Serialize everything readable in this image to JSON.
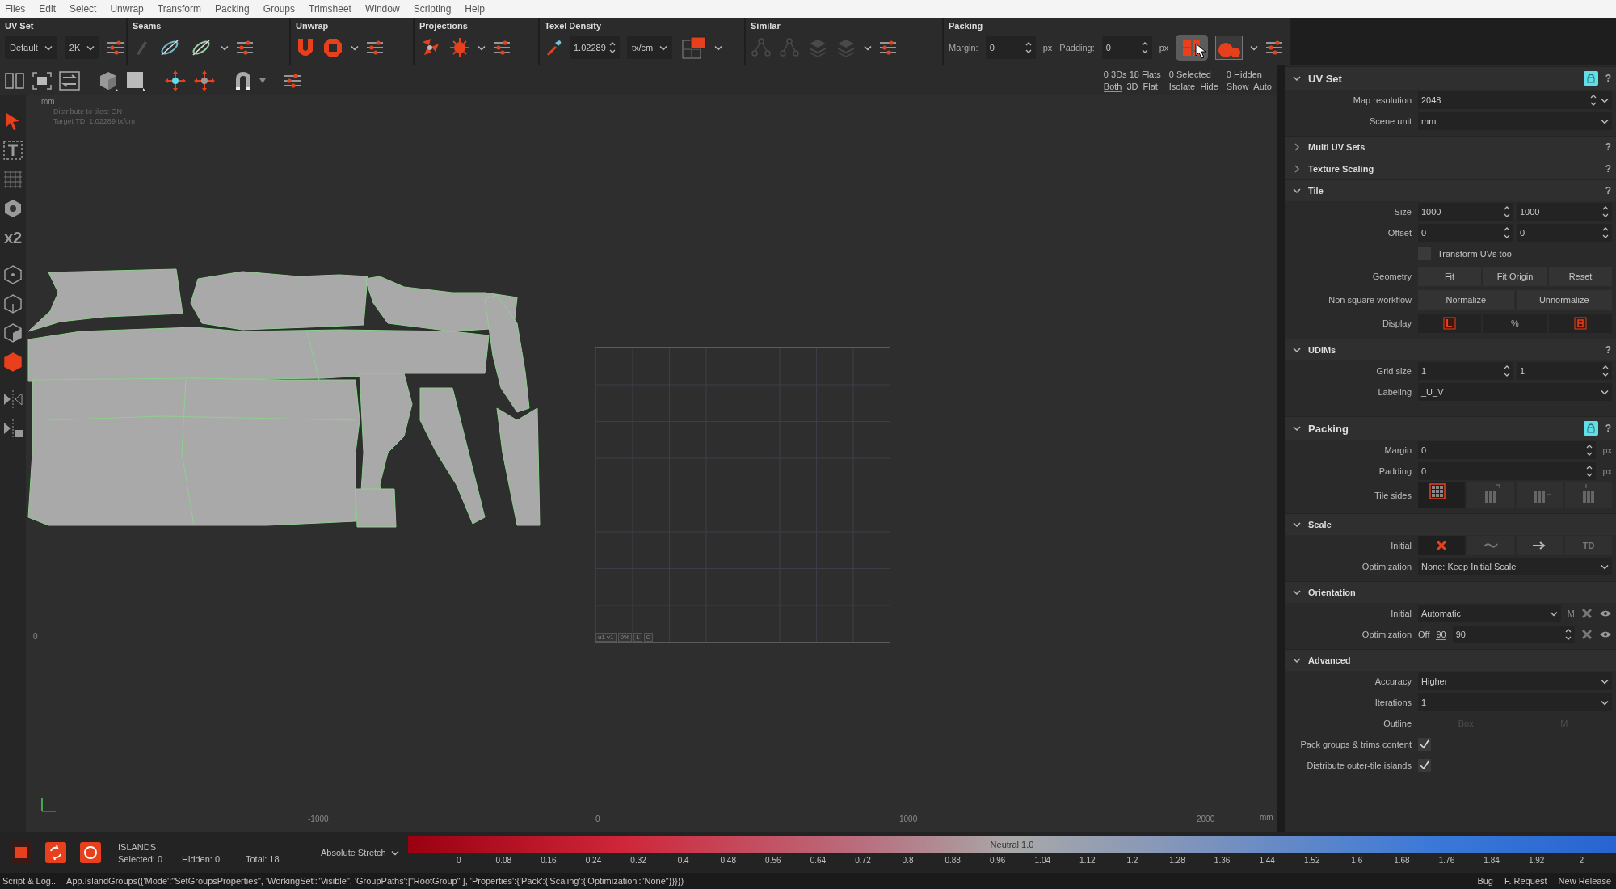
{
  "menu": [
    "Files",
    "Edit",
    "Select",
    "Unwrap",
    "Transform",
    "Packing",
    "Groups",
    "Trimsheet",
    "Window",
    "Scripting",
    "Help"
  ],
  "toolbar": [
    {
      "title": "UV Set",
      "controls": [
        {
          "kind": "select",
          "value": "Default"
        },
        {
          "kind": "select",
          "value": "2K"
        }
      ]
    },
    {
      "title": "Seams"
    },
    {
      "title": "Unwrap"
    },
    {
      "title": "Projections"
    },
    {
      "title": "Texel Density",
      "controls": [
        {
          "kind": "spin",
          "value": "1.02289"
        },
        {
          "kind": "select",
          "value": "tx/cm"
        }
      ]
    },
    {
      "title": "Similar",
      "disabled": true
    },
    {
      "title": "Packing",
      "controls": [
        {
          "kind": "label",
          "text": "Margin:"
        },
        {
          "kind": "spin",
          "value": "0"
        },
        {
          "kind": "unit",
          "text": "px"
        },
        {
          "kind": "label",
          "text": "Padding:"
        },
        {
          "kind": "spin",
          "value": "0"
        },
        {
          "kind": "unit",
          "text": "px"
        }
      ]
    }
  ],
  "view_stats": [
    "0 3Ds 18 Flats",
    "0 Selected",
    "0 Hidden"
  ],
  "view_modes": [
    {
      "label": "Both",
      "selected": true
    },
    {
      "label": "3D",
      "selected": false
    },
    {
      "label": "Flat",
      "selected": false
    }
  ],
  "view_actions": [
    "Isolate",
    "Hide",
    "Show",
    "Auto"
  ],
  "tools": [
    {
      "selected": true
    },
    {
      "selected": false
    },
    {
      "selected": false
    },
    {
      "selected": false
    },
    {
      "text": "x2",
      "selected": false
    },
    {
      "selected": false
    },
    {
      "selected": false
    },
    {
      "selected": false
    },
    {
      "selected": true
    },
    {
      "selected": false
    },
    {
      "selected": false
    }
  ],
  "viewport": {
    "unit": "mm",
    "info": [
      "Distribute to tiles: ON",
      "Target TD: 1.02289 tx/cm"
    ],
    "y_label": "0",
    "x_labels": [
      "-1000",
      "0",
      "1000",
      "2000"
    ],
    "x_unit": "mm",
    "tile_labels": [
      "u1 v1",
      "0%",
      "L",
      "C"
    ]
  },
  "panels": [
    {
      "title": "UV Set",
      "expanded": true,
      "locked": true,
      "help": "?",
      "rows": [
        {
          "kind": "spin-select",
          "label": "Map resolution",
          "value": "2048"
        },
        {
          "kind": "select",
          "label": "Scene unit",
          "value": "mm"
        }
      ],
      "sections": [
        {
          "title": "Multi UV Sets",
          "expanded": false,
          "help": "?"
        },
        {
          "title": "Texture Scaling",
          "expanded": false,
          "help": "?"
        },
        {
          "title": "Tile",
          "expanded": true,
          "help": "?",
          "rows": [
            {
              "kind": "spin2",
              "label": "Size",
              "values": [
                "1000",
                "1000"
              ]
            },
            {
              "kind": "spin2",
              "label": "Offset",
              "values": [
                "0",
                "0"
              ]
            },
            {
              "kind": "check",
              "text": "Transform UVs too",
              "checked": false
            },
            {
              "kind": "buttons",
              "label": "Geometry",
              "buttons": [
                "Fit",
                "Fit Origin",
                "Reset"
              ]
            },
            {
              "kind": "buttons",
              "label": "Non square workflow",
              "buttons": [
                "Normalize",
                "Unnormalize"
              ]
            },
            {
              "kind": "display",
              "label": "Display",
              "items": [
                {
                  "kind": "glyph"
                },
                {
                  "kind": "text",
                  "text": "%"
                },
                {
                  "kind": "glyph"
                }
              ]
            }
          ]
        },
        {
          "title": "UDIMs",
          "expanded": true,
          "help": "?",
          "rows": [
            {
              "kind": "spin2",
              "label": "Grid size",
              "values": [
                "1",
                "1"
              ]
            },
            {
              "kind": "select",
              "label": "Labeling",
              "value": "_U_V"
            }
          ]
        }
      ]
    },
    {
      "title": "Packing",
      "expanded": true,
      "locked": true,
      "help": "?",
      "rows": [
        {
          "kind": "spin-unit",
          "label": "Margin",
          "value": "0",
          "unit": "px"
        },
        {
          "kind": "spin-unit",
          "label": "Padding",
          "value": "0",
          "unit": "px"
        },
        {
          "kind": "tile-sides",
          "label": "Tile sides",
          "items": [
            {
              "selected": true
            },
            {
              "selected": false
            },
            {
              "selected": false
            },
            {
              "selected": false
            }
          ]
        }
      ],
      "sections": [
        {
          "title": "Scale",
          "expanded": true,
          "rows": [
            {
              "kind": "scale-initial",
              "label": "Initial",
              "items": [
                {
                  "kind": "glyph",
                  "selected": true
                },
                {
                  "kind": "glyph",
                  "selected": false
                },
                {
                  "kind": "glyph",
                  "selected": false
                },
                {
                  "kind": "text",
                  "text": "TD",
                  "selected": false
                }
              ]
            },
            {
              "kind": "select",
              "label": "Optimization",
              "value": "None: Keep Initial Scale"
            }
          ]
        },
        {
          "title": "Orientation",
          "expanded": true,
          "rows": [
            {
              "kind": "orient-select",
              "label": "Initial",
              "value": "Automatic",
              "toggle": "M"
            },
            {
              "kind": "orient-spin",
              "label": "Optimization",
              "toggle": "Off",
              "step": "90",
              "value": "90"
            }
          ]
        },
        {
          "title": "Advanced",
          "expanded": true,
          "rows": [
            {
              "kind": "select",
              "label": "Accuracy",
              "value": "Higher"
            },
            {
              "kind": "select",
              "label": "Iterations",
              "value": "1"
            },
            {
              "kind": "outline",
              "label": "Outline",
              "items": [
                "Box",
                "M"
              ],
              "disabled": true
            },
            {
              "kind": "check-left",
              "label": "Pack groups & trims content",
              "checked": true
            },
            {
              "kind": "check-left",
              "label": "Distribute outer-tile islands",
              "checked": true
            }
          ]
        }
      ]
    }
  ],
  "islands": {
    "title": "ISLANDS",
    "stats": [
      "Selected: 0",
      "Hidden: 0",
      "Total: 18"
    ]
  },
  "stretch": {
    "mode": "Absolute Stretch",
    "neutral": "Neutral 1.0",
    "ticks": [
      "0",
      "0.08",
      "0.16",
      "0.24",
      "0.32",
      "0.4",
      "0.48",
      "0.56",
      "0.64",
      "0.72",
      "0.8",
      "0.88",
      "0.96",
      "1.04",
      "1.12",
      "1.2",
      "1.28",
      "1.36",
      "1.44",
      "1.52",
      "1.6",
      "1.68",
      "1.76",
      "1.84",
      "1.92",
      "2"
    ]
  },
  "status": {
    "console": "Script & Log...",
    "command": "App.IslandGroups({'Mode':\"SetGroupsProperties\", 'WorkingSet':\"Visible\", 'GroupPaths':[\"RootGroup\" ], 'Properties':{'Pack':{'Scaling':{'Optimization':\"None\"}}}})",
    "links": [
      "Bug",
      "F. Request",
      "New Release"
    ]
  }
}
